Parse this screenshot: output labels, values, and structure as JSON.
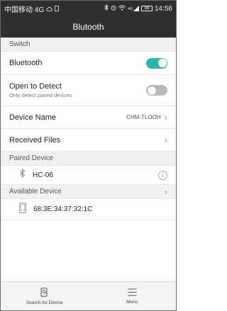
{
  "statusbar": {
    "carrier": "中国移动 4G",
    "signal": "4G",
    "battery": "98",
    "time": "14:56"
  },
  "titlebar": {
    "title": "Blutooth"
  },
  "sections": {
    "switch": "Switch",
    "paired": "Paired Device",
    "available": "Available Device"
  },
  "rows": {
    "bluetooth": {
      "label": "Bluetooth",
      "on": true
    },
    "open_detect": {
      "label": "Open to Detect",
      "sublabel": "Only detect paired devices",
      "on": false
    },
    "device_name": {
      "label": "Device Name",
      "value": "CHM-TLOOH"
    },
    "received_files": {
      "label": "Received Files"
    }
  },
  "paired_devices": [
    {
      "name": "HC-06",
      "icon": "bluetooth-icon"
    }
  ],
  "available_devices": [
    {
      "name": "68:3E:34:37:32:1C",
      "icon": "phone-icon"
    }
  ],
  "bottombar": {
    "search_label": "Search for Device",
    "menu_label": "Menu"
  },
  "colors": {
    "accent": "#2fb5a8",
    "titlebar": "#303030",
    "statusbar": "#2f2f2f"
  }
}
